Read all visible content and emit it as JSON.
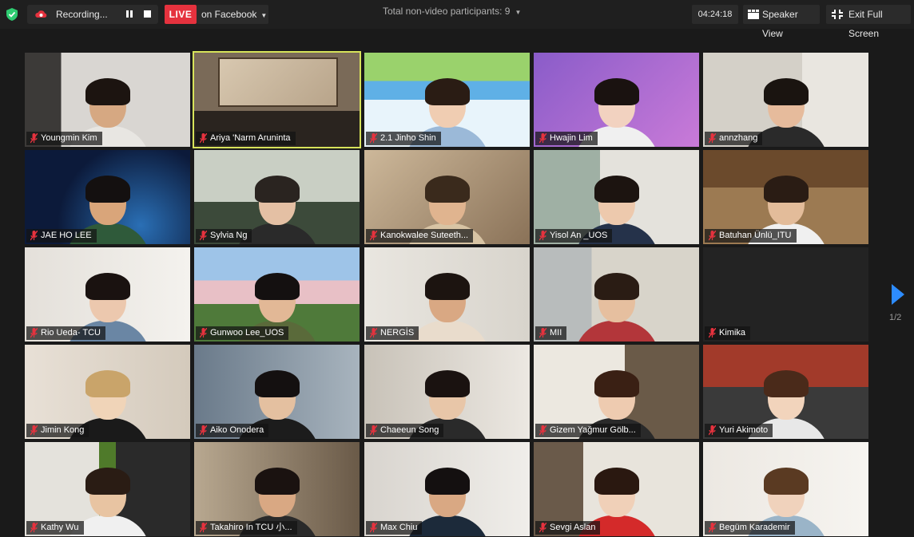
{
  "topbar": {
    "recording_label": "Recording...",
    "live_badge": "LIVE",
    "live_platform": "on Facebook",
    "participants_label": "Total non-video participants: 9",
    "timer": "04:24:18",
    "speaker_view_label": "Speaker View",
    "exit_fullscreen_label": "Exit Full Screen",
    "accent_live": "#e5323e",
    "accent_shield": "#2ecc71"
  },
  "gallery": {
    "active_speaker_color": "#d7e35a",
    "page_indicator": "1/2",
    "tiles": [
      {
        "name": "Youngmin Kim"
      },
      {
        "name": "Ariya 'Narm Aruninta"
      },
      {
        "name": "2.1 Jinho Shin"
      },
      {
        "name": "Hwajin Lim"
      },
      {
        "name": "annzhang"
      },
      {
        "name": "JAE HO LEE"
      },
      {
        "name": "Sylvia Ng"
      },
      {
        "name": "Kanokwalee Suteeth..."
      },
      {
        "name": "Yisol An _UOS"
      },
      {
        "name": "Batuhan Ünlü_ITU"
      },
      {
        "name": "Rio Ueda- TCU"
      },
      {
        "name": "Gunwoo Lee_UOS"
      },
      {
        "name": "NERGİS"
      },
      {
        "name": "MII"
      },
      {
        "name": "Kimika"
      },
      {
        "name": "Jimin Kong"
      },
      {
        "name": "Aiko Onodera"
      },
      {
        "name": "Chaeeun Song"
      },
      {
        "name": "Gizem Yağmur Gölb..."
      },
      {
        "name": "Yuri Akimoto"
      },
      {
        "name": "Kathy Wu"
      },
      {
        "name": "Takahiro In TCU 小..."
      },
      {
        "name": "Max Chiu"
      },
      {
        "name": "Sevgi Aslan"
      },
      {
        "name": "Begüm Karademir"
      }
    ]
  }
}
